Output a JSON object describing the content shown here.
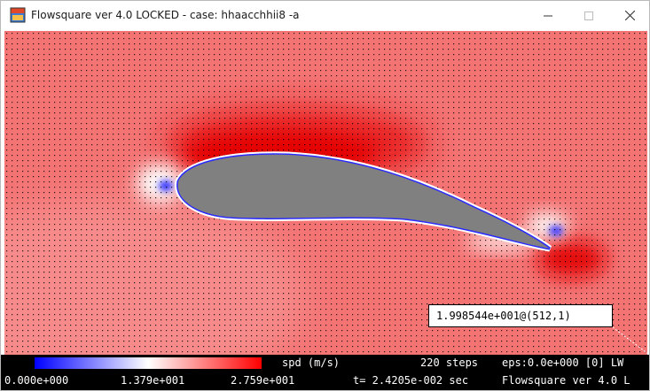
{
  "window": {
    "title": "Flowsquare ver 4.0 LOCKED - case: hhaacchhii8 -a",
    "buttons": {
      "minimize": "minimize",
      "maximize": "maximize",
      "close": "close"
    }
  },
  "simulation": {
    "field": "speed",
    "probe_readout": "1.998544e+001@(512,1)"
  },
  "status_bar": {
    "variable_label": "spd (m/s)",
    "steps": "220 steps",
    "eps": "eps:0.0e+000 [0] LW",
    "scale_min": "0.000e+000",
    "scale_mid": "1.379e+001",
    "scale_max": "2.759e+001",
    "time": "t= 2.4205e-002 sec",
    "version": "Flowsquare ver 4.0 L",
    "colorbar_colors": [
      "#0000ff",
      "#ffffff",
      "#ff0000"
    ]
  },
  "colors": {
    "background_flow": "#f26a6a",
    "high_speed": "#e80000",
    "stagnation": "#ffffff",
    "low_speed": "#2020ff",
    "body": "#808080"
  }
}
